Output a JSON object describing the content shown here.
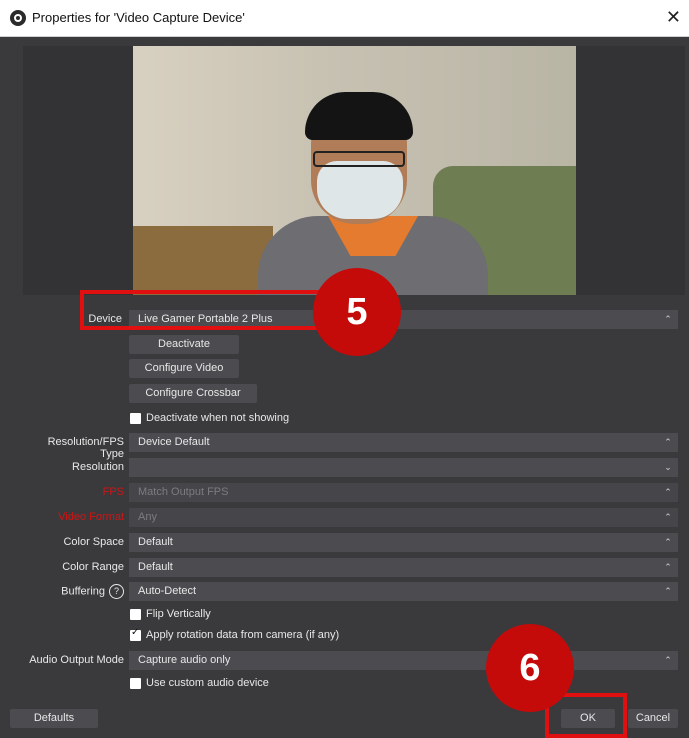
{
  "window": {
    "title": "Properties for 'Video Capture Device'",
    "close_glyph": "✕"
  },
  "annotations": {
    "badge_device": "5",
    "badge_ok": "6",
    "color": "#e01010"
  },
  "properties": {
    "device": {
      "label": "Device",
      "value": "Live Gamer Portable 2 Plus"
    },
    "deactivate_label": "Deactivate",
    "configure_video_label": "Configure Video",
    "configure_crossbar_label": "Configure Crossbar",
    "deactivate_when_not_showing": {
      "label": "Deactivate when not showing",
      "checked": false
    },
    "resolution_fps_type": {
      "label": "Resolution/FPS Type",
      "value": "Device Default"
    },
    "resolution": {
      "label": "Resolution",
      "value": ""
    },
    "fps": {
      "label": "FPS",
      "value": "Match Output FPS",
      "label_color": "#d01414"
    },
    "video_format": {
      "label": "Video Format",
      "value": "Any",
      "label_color": "#d01414"
    },
    "color_space": {
      "label": "Color Space",
      "value": "Default"
    },
    "color_range": {
      "label": "Color Range",
      "value": "Default"
    },
    "buffering": {
      "label": "Buffering",
      "value": "Auto-Detect",
      "help": "?"
    },
    "flip_vertically": {
      "label": "Flip Vertically",
      "checked": false
    },
    "apply_rotation": {
      "label": "Apply rotation data from camera (if any)",
      "checked": true
    },
    "audio_output_mode": {
      "label": "Audio Output Mode",
      "value": "Capture audio only"
    },
    "use_custom_audio": {
      "label": "Use custom audio device",
      "checked": false
    }
  },
  "footer": {
    "defaults_label": "Defaults",
    "ok_label": "OK",
    "cancel_label": "Cancel"
  },
  "icons": {
    "spin": "⌃⌄",
    "dropdown": "⌄"
  }
}
